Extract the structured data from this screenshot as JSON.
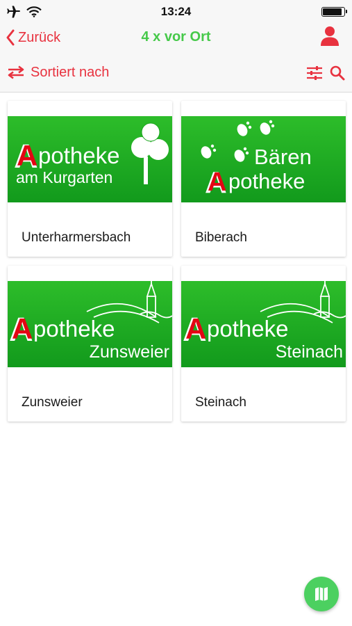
{
  "statusbar": {
    "time": "13:24",
    "battery_level": 0.9,
    "icons": [
      "airplane-icon",
      "wifi-icon",
      "battery-icon"
    ]
  },
  "navbar": {
    "back_label": "Zurück",
    "title": "4 x vor Ort",
    "icons": [
      "chevron-left-icon",
      "user-icon"
    ]
  },
  "toolbar": {
    "sort_label": "Sortiert nach",
    "icons": [
      "sort-arrows-icon",
      "filter-sliders-icon",
      "search-icon"
    ]
  },
  "cards": [
    {
      "label": "Unterharmersbach",
      "logo": {
        "line1": "potheke",
        "line2": "am Kurgarten",
        "pharmacy_a": "A"
      }
    },
    {
      "label": "Biberach",
      "logo": {
        "line1": "Bären",
        "line2": "potheke",
        "pharmacy_a": "A"
      }
    },
    {
      "label": "Zunsweier",
      "logo": {
        "line1": "potheke",
        "line2": "Zunsweier",
        "pharmacy_a": "A"
      }
    },
    {
      "label": "Steinach",
      "logo": {
        "line1": "potheke",
        "line2": "Steinach",
        "pharmacy_a": "A"
      }
    }
  ],
  "map_fab": {
    "icon": "map-icon"
  },
  "colors": {
    "accent_red": "#e8323f",
    "title_green": "#46c94a",
    "logo_green": "#22b025",
    "fab_green": "#4cd060",
    "bar_background": "#f7f7f7"
  }
}
